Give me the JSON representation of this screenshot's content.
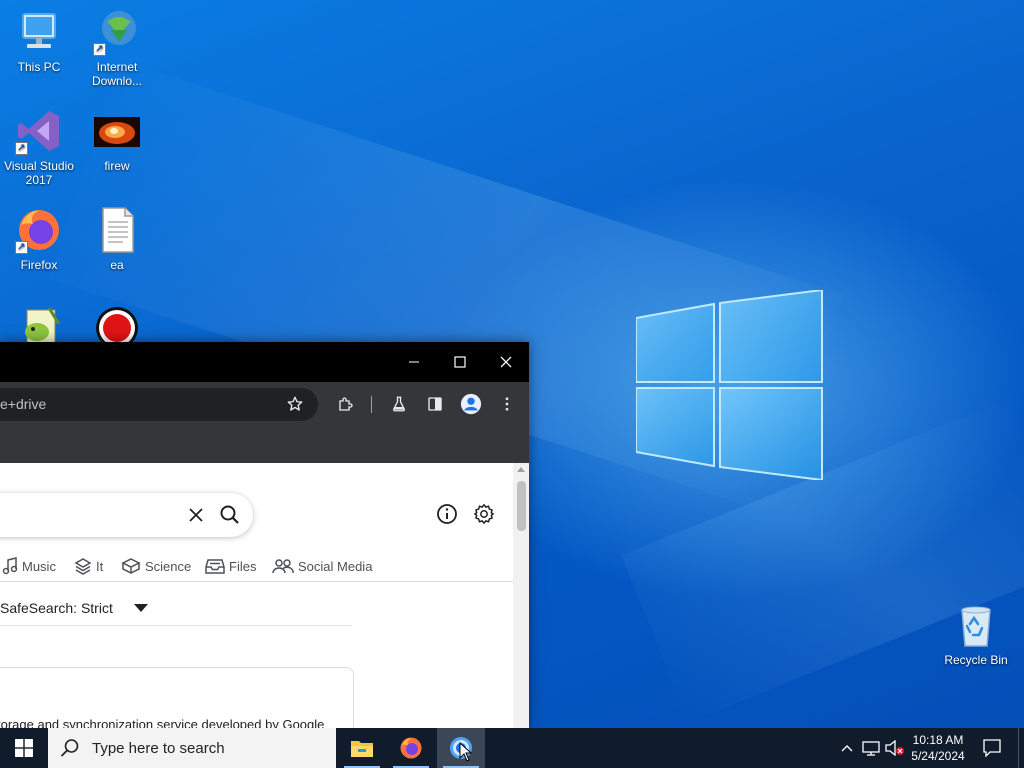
{
  "desktop": {
    "icons": [
      {
        "label": "This PC",
        "icon": "computer-icon"
      },
      {
        "label": "Internet Downlo...",
        "icon": "internet-download-manager-icon"
      },
      {
        "label": "Visual Studio 2017",
        "icon": "visual-studio-icon"
      },
      {
        "label": "firew",
        "icon": "image-file-icon"
      },
      {
        "label": "Firefox",
        "icon": "firefox-icon"
      },
      {
        "label": "ea",
        "icon": "text-file-icon"
      },
      {
        "label": "",
        "icon": "notepad-plus-plus-icon"
      },
      {
        "label": "",
        "icon": "record-icon"
      }
    ],
    "recycle_bin": {
      "label": "Recycle Bin",
      "icon": "recycle-bin-icon"
    }
  },
  "browser": {
    "address_text": "e+drive",
    "page": {
      "categories": [
        "Music",
        "It",
        "Science",
        "Files",
        "Social Media"
      ],
      "safesearch_label": "SafeSearch: Strict",
      "snippet": "torage and synchronization service developed by Google"
    }
  },
  "taskbar": {
    "search_placeholder": "Type here to search",
    "clock_time": "10:18 AM",
    "clock_date": "5/24/2024"
  },
  "colors": {
    "wallpaper_blue": "#0a6fd6",
    "taskbar_bg": "#101c2c",
    "browser_chrome": "#35363a",
    "accent_underline": "#8ec3ff"
  }
}
